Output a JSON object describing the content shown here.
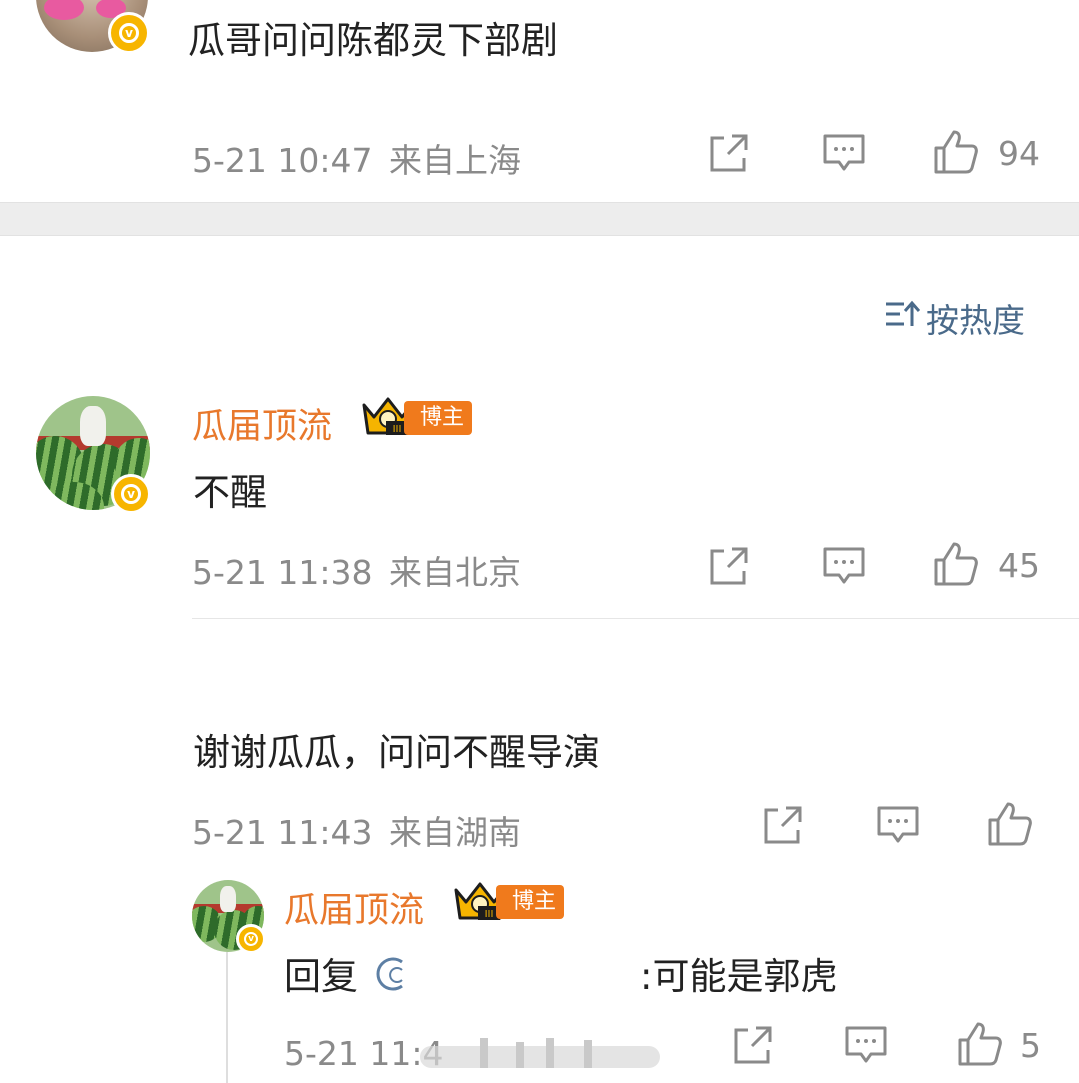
{
  "top_comment": {
    "text": "瓜哥问问陈都灵下部剧",
    "time": "5-21 10:47",
    "location": "来自上海",
    "likes": "94"
  },
  "sort": {
    "label": "按热度",
    "icon": "sort-icon"
  },
  "comment1": {
    "username": "瓜届顶流",
    "badge_level": "III",
    "badge_label": "博主",
    "text": "不醒",
    "time": "5-21 11:38",
    "location": "来自北京",
    "likes": "45"
  },
  "comment2": {
    "text": "谢谢瓜瓜，问问不醒导演",
    "time": "5-21 11:43",
    "location": "来自湖南"
  },
  "reply": {
    "username": "瓜届顶流",
    "badge_level": "III",
    "badge_label": "博主",
    "prefix": "回复",
    "text": ":可能是郭虎",
    "time": "5-21 11:4",
    "likes": "5"
  },
  "colors": {
    "accent_username": "#e8782c",
    "meta_gray": "#8a8a8a",
    "verified": "#f7b500",
    "sort_blue": "#4a6a8a"
  }
}
